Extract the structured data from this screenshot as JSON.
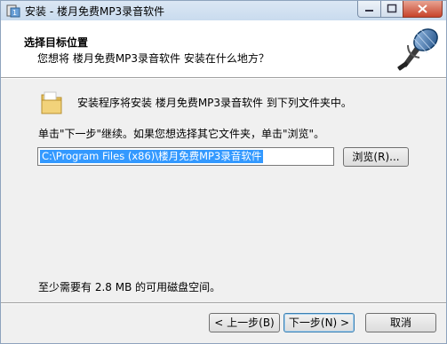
{
  "window": {
    "title": "安装 - 楼月免费MP3录音软件",
    "minimize_glyph": "─",
    "maximize_glyph": "□",
    "close_glyph": "x"
  },
  "header": {
    "title": "选择目标位置",
    "subtitle": "您想将 楼月免费MP3录音软件 安装在什么地方？",
    "logo_icon": "microphone-icon"
  },
  "body": {
    "folder_icon": "folder-icon",
    "info_text": "安装程序将安装 楼月免费MP3录音软件 到下列文件夹中。",
    "instruction_text": "单击\"下一步\"继续。如果您想选择其它文件夹，单击\"浏览\"。",
    "install_path": "C:\\Program Files (x86)\\楼月免费MP3录音软件",
    "browse_label": "浏览(R)...",
    "disk_space_text": "至少需要有 2.8 MB 的可用磁盘空间。"
  },
  "footer": {
    "back_label": "< 上一步(B)",
    "next_label": "下一步(N) >",
    "cancel_label": "取消"
  },
  "colors": {
    "selection": "#3399ff",
    "close_button": "#c7432a",
    "dialog_bg": "#f0f0f0"
  }
}
